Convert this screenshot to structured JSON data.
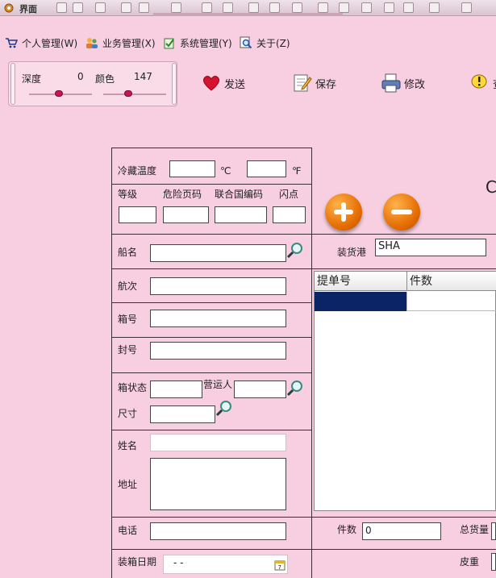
{
  "window": {
    "title": "界面"
  },
  "menu": [
    {
      "label": "个人管理(W)",
      "icon": "cart-icon"
    },
    {
      "label": "业务管理(X)",
      "icon": "users-icon"
    },
    {
      "label": "系统管理(Y)",
      "icon": "check-icon"
    },
    {
      "label": "关于(Z)",
      "icon": "magnifier-icon"
    }
  ],
  "sliders": {
    "depth": {
      "label": "深度",
      "value": "0"
    },
    "color": {
      "label": "颜色",
      "value": "147"
    }
  },
  "toolbar": {
    "send": "发送",
    "save": "保存",
    "modify": "修改",
    "view": "查"
  },
  "form": {
    "reefer_temp": "冷藏温度",
    "celsius": "℃",
    "fahrenheit": "℉",
    "grade": "等级",
    "dangerous_page": "危险页码",
    "un_code": "联合国编码",
    "flash_point": "闪点",
    "vessel": "船名",
    "voyage": "航次",
    "container_no": "箱号",
    "seal_no": "封号",
    "container_status": "箱状态",
    "operator": "营运人",
    "size": "尺寸",
    "name": "姓名",
    "address": "地址",
    "phone": "电话",
    "packing_date": "装箱日期",
    "packing_date_value": "- -",
    "loading_port": "装货港",
    "loading_port_value": "SHA",
    "pieces": "件数",
    "pieces_value": "0",
    "total_weight": "总货量",
    "tare": "皮重",
    "partial_letter": "C"
  },
  "grid": {
    "columns": [
      "提单号",
      "件数"
    ]
  },
  "colors": {
    "background": "#f7cfe0",
    "selection": "#0a2466",
    "accent_orange": "#e46a00"
  }
}
